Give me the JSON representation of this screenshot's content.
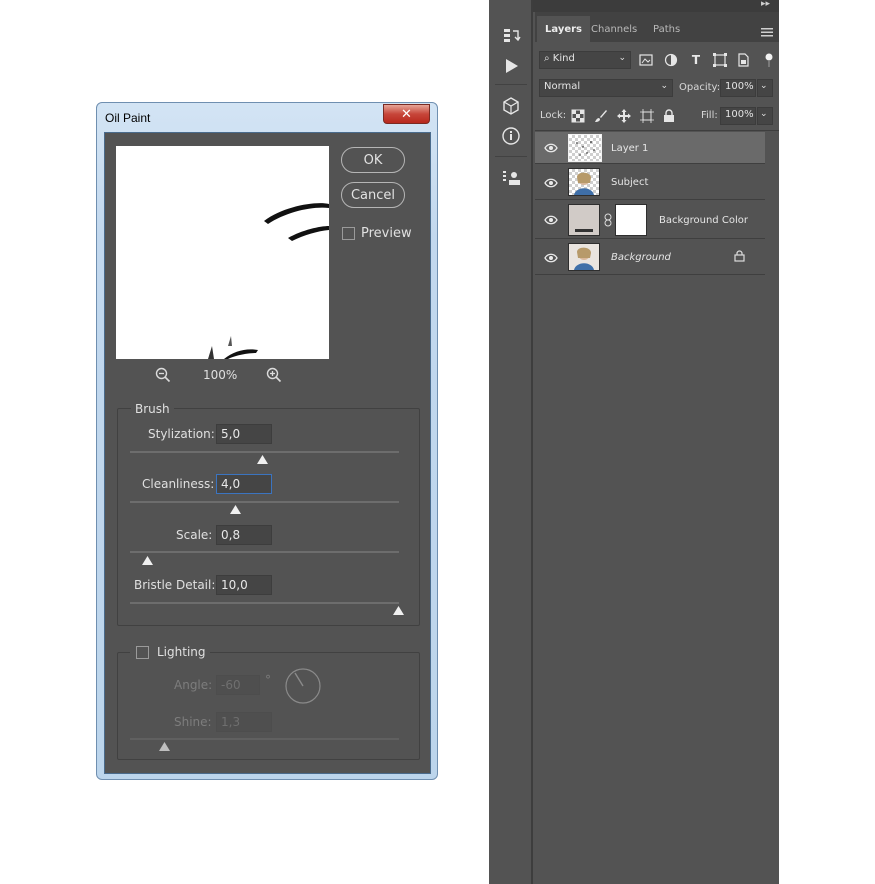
{
  "dialog": {
    "title": "Oil Paint",
    "close_glyph": "✕",
    "ok_label": "OK",
    "cancel_label": "Cancel",
    "preview_label": "Preview",
    "preview_checked": false,
    "zoom": "100%",
    "zoom_out_icon": "zoom-out-icon",
    "zoom_in_icon": "zoom-in-icon",
    "brush": {
      "group_label": "Brush",
      "stylization": {
        "label": "Stylization:",
        "value": "5,0",
        "slider_fraction": 0.49
      },
      "cleanliness": {
        "label": "Cleanliness:",
        "value": "4,0",
        "slider_fraction": 0.39
      },
      "scale": {
        "label": "Scale:",
        "value": "0,8",
        "slider_fraction": 0.06
      },
      "bristle_detail": {
        "label": "Bristle Detail:",
        "value": "10,0",
        "slider_fraction": 1.0
      }
    },
    "lighting": {
      "label": "Lighting",
      "checked": false,
      "angle": {
        "label": "Angle:",
        "value": "-60",
        "unit": "°"
      },
      "shine": {
        "label": "Shine:",
        "value": "1,3",
        "slider_fraction": 0.12
      }
    }
  },
  "layers_panel": {
    "tabs": [
      "Layers",
      "Channels",
      "Paths"
    ],
    "active_tab": "Layers",
    "filter_kind": "Kind",
    "blend_mode": "Normal",
    "opacity_label": "Opacity:",
    "opacity_value": "100%",
    "lock_label": "Lock:",
    "fill_label": "Fill:",
    "fill_value": "100%",
    "layers": [
      {
        "name": "Layer 1",
        "selected": true,
        "italic": false
      },
      {
        "name": "Subject",
        "selected": false,
        "italic": false
      },
      {
        "name": "Background Color",
        "selected": false,
        "italic": false
      },
      {
        "name": "Background",
        "selected": false,
        "italic": true,
        "locked": true
      }
    ]
  },
  "colors": {
    "panel_bg": "#535353",
    "title_bar": "#c2d8ee",
    "close_red": "#c7463a",
    "focus_blue": "#3b74c0"
  }
}
